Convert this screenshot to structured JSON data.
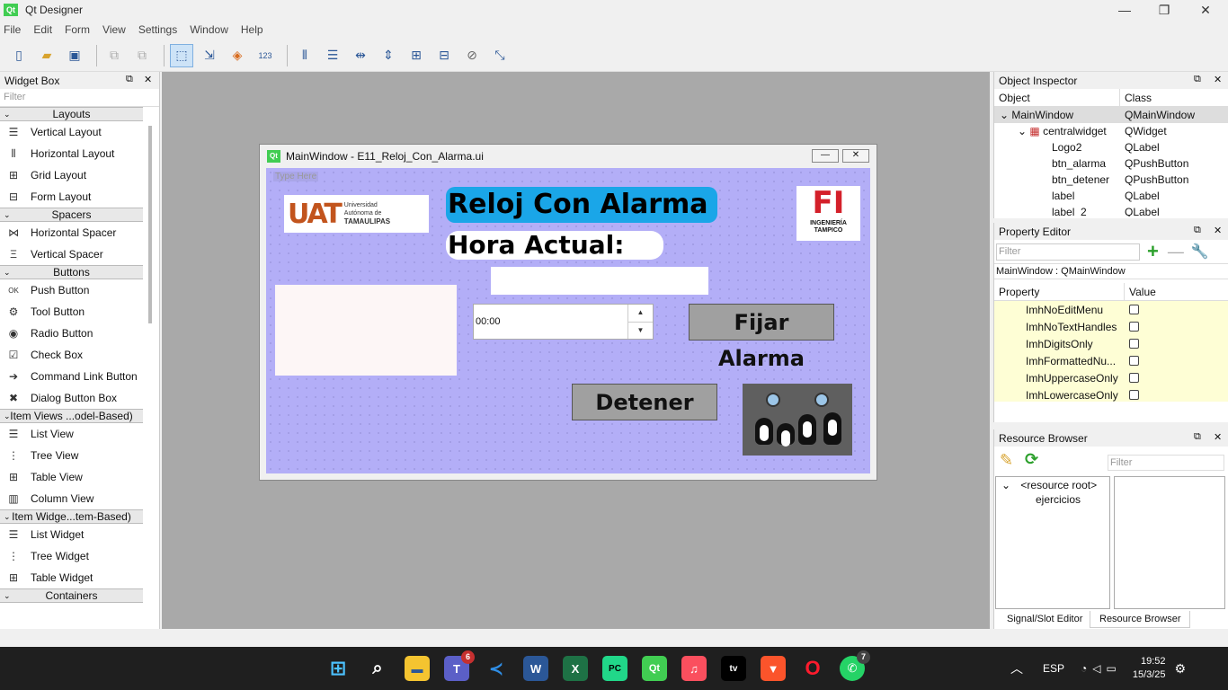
{
  "app": {
    "title": "Qt Designer",
    "qt_logo": "Qt"
  },
  "menu": [
    "File",
    "Edit",
    "Form",
    "View",
    "Settings",
    "Window",
    "Help"
  ],
  "toolbar_icons": [
    "new-file-icon",
    "open-folder-icon",
    "save-icon",
    "sep",
    "copy-icon",
    "paste-icon",
    "sep",
    "edit-widgets-icon",
    "edit-signals-icon",
    "edit-buddies-icon",
    "edit-tab-order-icon",
    "sep",
    "layout-horizontal-icon",
    "layout-vertical-icon",
    "layout-h-splitter-icon",
    "layout-v-splitter-icon",
    "layout-grid-icon",
    "layout-form-icon",
    "break-layout-icon",
    "adjust-size-icon"
  ],
  "widget_box": {
    "title": "Widget Box",
    "filter": "Filter",
    "sections": [
      {
        "name": "Layouts",
        "items": [
          "Vertical Layout",
          "Horizontal Layout",
          "Grid Layout",
          "Form Layout"
        ]
      },
      {
        "name": "Spacers",
        "items": [
          "Horizontal Spacer",
          "Vertical Spacer"
        ]
      },
      {
        "name": "Buttons",
        "items": [
          "Push Button",
          "Tool Button",
          "Radio Button",
          "Check Box",
          "Command Link Button",
          "Dialog Button Box"
        ]
      },
      {
        "name": "Item Views ...odel-Based)",
        "items": [
          "List View",
          "Tree View",
          "Table View",
          "Column View"
        ]
      },
      {
        "name": "Item Widge...tem-Based)",
        "items": [
          "List Widget",
          "Tree Widget",
          "Table Widget"
        ]
      },
      {
        "name": "Containers",
        "items": []
      }
    ]
  },
  "form": {
    "title": "MainWindow - E11_Reloj_Con_Alarma.ui",
    "type_here": "Type Here",
    "uat_logo": "UAT",
    "uat_line1": "Universidad",
    "uat_line2": "Autónoma de",
    "uat_line3": "TAMAULIPAS",
    "title_label": "Reloj Con Alarma",
    "hora_label": "Hora Actual:",
    "fi_logo": "FI",
    "fi_line1": "INGENIERÍA",
    "fi_line2": "TAMPICO",
    "time_value": "00:00",
    "fijar_button": "Fijar Alarma",
    "detener_button": "Detener"
  },
  "object_inspector": {
    "title": "Object Inspector",
    "col_object": "Object",
    "col_class": "Class",
    "rows": [
      {
        "object": "MainWindow",
        "class": "QMainWindow"
      },
      {
        "object": "centralwidget",
        "class": "QWidget"
      },
      {
        "object": "Logo2",
        "class": "QLabel"
      },
      {
        "object": "btn_alarma",
        "class": "QPushButton"
      },
      {
        "object": "btn_detener",
        "class": "QPushButton"
      },
      {
        "object": "label",
        "class": "QLabel"
      },
      {
        "object": "label_2",
        "class": "QLabel"
      }
    ]
  },
  "property_editor": {
    "title": "Property Editor",
    "filter": "Filter",
    "context": "MainWindow : QMainWindow",
    "col_property": "Property",
    "col_value": "Value",
    "rows": [
      "ImhNoEditMenu",
      "ImhNoTextHandles",
      "ImhDigitsOnly",
      "ImhFormattedNu...",
      "ImhUppercaseOnly",
      "ImhLowercaseOnly"
    ]
  },
  "resource_browser": {
    "title": "Resource Browser",
    "filter": "Filter",
    "root": "<resource root>",
    "child": "ejercicios",
    "tab_signal": "Signal/Slot Editor",
    "tab_resource": "Resource Browser"
  },
  "taskbar": {
    "teams_badge": "6",
    "whatsapp_badge": "7",
    "lang": "ESP",
    "time": "19:52",
    "date": "15/3/25",
    "app_tv": "tv"
  }
}
